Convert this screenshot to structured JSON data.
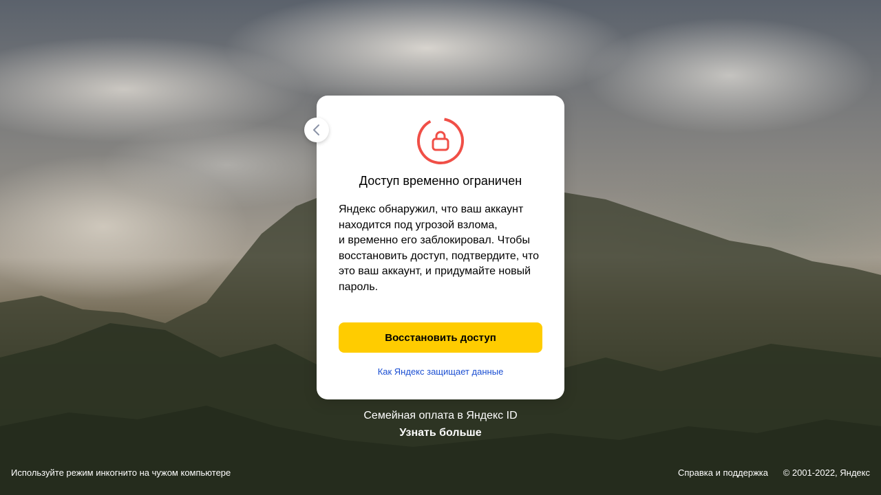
{
  "card": {
    "title": "Доступ временно ограничен",
    "text": "Яндекс обнаружил, что ваш аккаунт\nнаходится под угрозой взлома,\nи временно его заблокировал. Чтобы\nвосстановить доступ, подтвердите, что\nэто ваш аккаунт, и придумайте новый\nпароль.",
    "primary_button": "Восстановить доступ",
    "link": "Как Яндекс защищает данные",
    "icon": "lock-icon",
    "icon_color": "#f04f47"
  },
  "back_button_icon": "chevron-left-icon",
  "promo": {
    "text": "Семейная оплата в Яндекс ID",
    "link": "Узнать больше"
  },
  "footer": {
    "incognito_hint": "Используйте режим инкогнито на чужом компьютере",
    "help_link": "Справка и поддержка",
    "copyright": "© 2001-2022, Яндекс"
  },
  "colors": {
    "accent_button": "#ffcc00",
    "link": "#1a4ed2"
  }
}
